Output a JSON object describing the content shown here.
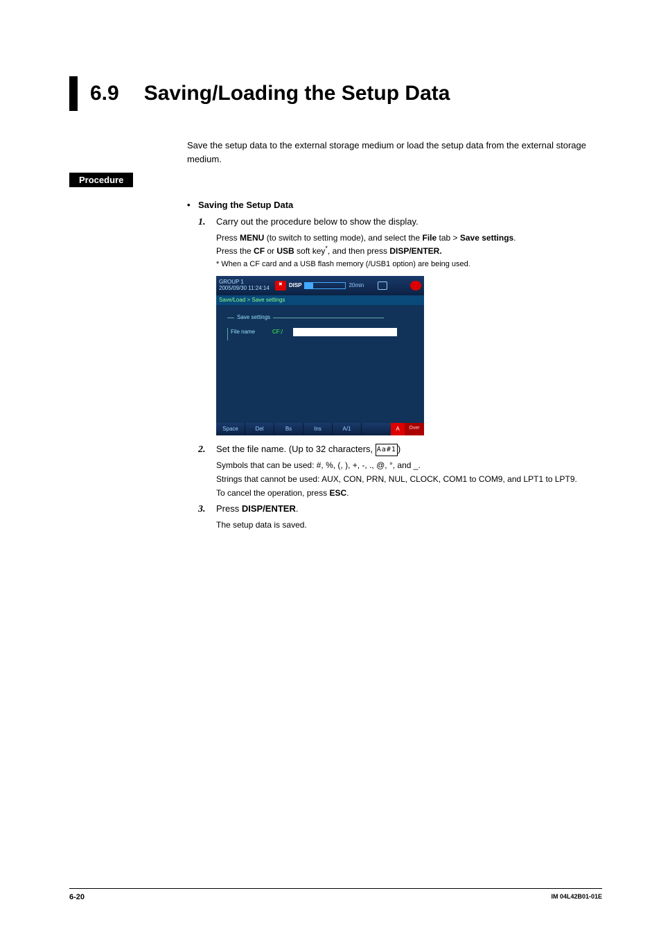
{
  "heading": {
    "num": "6.9",
    "title": "Saving/Loading the Setup Data"
  },
  "intro": "Save the setup data to the external storage medium or load the setup data from the external storage medium.",
  "procedure_label": "Procedure",
  "section": {
    "bullet": "Saving the Setup Data",
    "step1": {
      "n": "1.",
      "l1": "Carry out the procedure below to show the display.",
      "l2a": "Press ",
      "l2b": "MENU",
      "l2c": " (to switch to setting mode), and select the ",
      "l2d": "File",
      "l2e": " tab > ",
      "l2f": "Save settings",
      "l2g": ".",
      "l3a": "Press the ",
      "l3b": "CF",
      "l3c": " or ",
      "l3d": "USB",
      "l3e": " soft key",
      "l3f": ", and then press ",
      "l3g": "DISP/ENTER.",
      "note": "*   When a CF card and a USB flash memory (/USB1 option) are being used."
    },
    "screenshot": {
      "group": "GROUP 1",
      "dt": "2005/09/30 11:24:14",
      "disp": "DISP",
      "min": "20min",
      "crumb": "Save/Load > Save settings",
      "legend": "Save settings",
      "filelabel": "File name",
      "cf": "CF:/",
      "sk": [
        "Space",
        "Del",
        "Bs",
        "Ins",
        "A/1"
      ],
      "rA": "A",
      "rOver": "Over"
    },
    "step2": {
      "n": "2.",
      "l1a": "Set the file name. (Up to 32 characters, ",
      "chars": "Aa#1",
      "l1b": ")",
      "s1": "Symbols that can be used: #, %, (, ), +, -, ., @, °, and _.",
      "s2": "Strings that cannot be used: AUX, CON, PRN, NUL, CLOCK, COM1 to COM9, and LPT1 to LPT9.",
      "s3a": "To cancel the operation, press ",
      "s3b": "ESC",
      "s3c": "."
    },
    "step3": {
      "n": "3.",
      "l1a": "Press ",
      "l1b": "DISP/ENTER",
      "l1c": ".",
      "s1": "The setup data is saved."
    }
  },
  "footer": {
    "page": "6-20",
    "doc": "IM 04L42B01-01E"
  }
}
